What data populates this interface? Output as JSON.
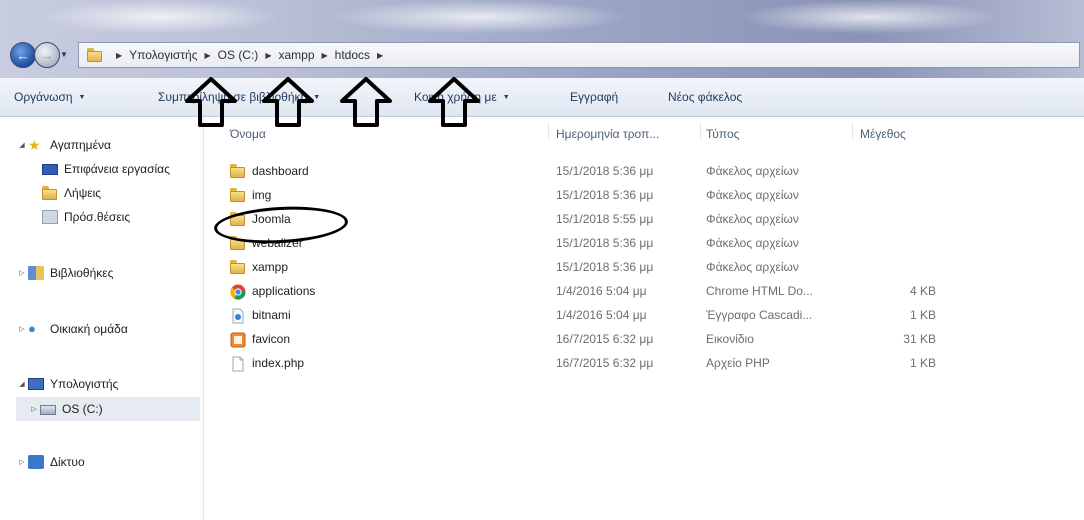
{
  "window": {
    "breadcrumb": [
      "Υπολογιστής",
      "OS (C:)",
      "xampp",
      "htdocs"
    ]
  },
  "toolbar": {
    "organize": "Οργάνωση",
    "burn": "Συμπερίληψη σε βιβλιοθήκη",
    "share": "Κοινή χρήση με",
    "record": "Εγγραφή",
    "new_folder": "Νέος φάκελος"
  },
  "nav": {
    "favorites": "Αγαπημένα",
    "desktop": "Επιφάνεια εργασίας",
    "downloads": "Λήψεις",
    "recent": "Πρόσ.θέσεις",
    "libraries": "Βιβλιοθήκες",
    "homegroup": "Οικιακή ομάδα",
    "computer": "Υπολογιστής",
    "drive": "OS (C:)",
    "network": "Δίκτυο"
  },
  "columns": {
    "name": "Όνομα",
    "date": "Ημερομηνία τροπ...",
    "type": "Τύπος",
    "size": "Μέγεθος"
  },
  "files": [
    {
      "name": "dashboard",
      "date": "15/1/2018 5:36 μμ",
      "type": "Φάκελος αρχείων",
      "size": "",
      "icon": "folder-icon"
    },
    {
      "name": "img",
      "date": "15/1/2018 5:36 μμ",
      "type": "Φάκελος αρχείων",
      "size": "",
      "icon": "folder-icon"
    },
    {
      "name": "Joomla",
      "date": "15/1/2018 5:55 μμ",
      "type": "Φάκελος αρχείων",
      "size": "",
      "icon": "folder-icon"
    },
    {
      "name": "webalizer",
      "date": "15/1/2018 5:36 μμ",
      "type": "Φάκελος αρχείων",
      "size": "",
      "icon": "folder-icon"
    },
    {
      "name": "xampp",
      "date": "15/1/2018 5:36 μμ",
      "type": "Φάκελος αρχείων",
      "size": "",
      "icon": "folder-icon"
    },
    {
      "name": "applications",
      "date": "1/4/2016 5:04 μμ",
      "type": "Chrome HTML Do...",
      "size": "4 KB",
      "icon": "chrome-icon"
    },
    {
      "name": "bitnami",
      "date": "1/4/2016 5:04 μμ",
      "type": "Έγγραφο Cascadi...",
      "size": "1 KB",
      "icon": "css-file-icon"
    },
    {
      "name": "favicon",
      "date": "16/7/2015 6:32 μμ",
      "type": "Εικονίδιο",
      "size": "31 KB",
      "icon": "ico-file-icon"
    },
    {
      "name": "index.php",
      "date": "16/7/2015 6:32 μμ",
      "type": "Αρχείο PHP",
      "size": "1 KB",
      "icon": "php-file-icon"
    }
  ]
}
